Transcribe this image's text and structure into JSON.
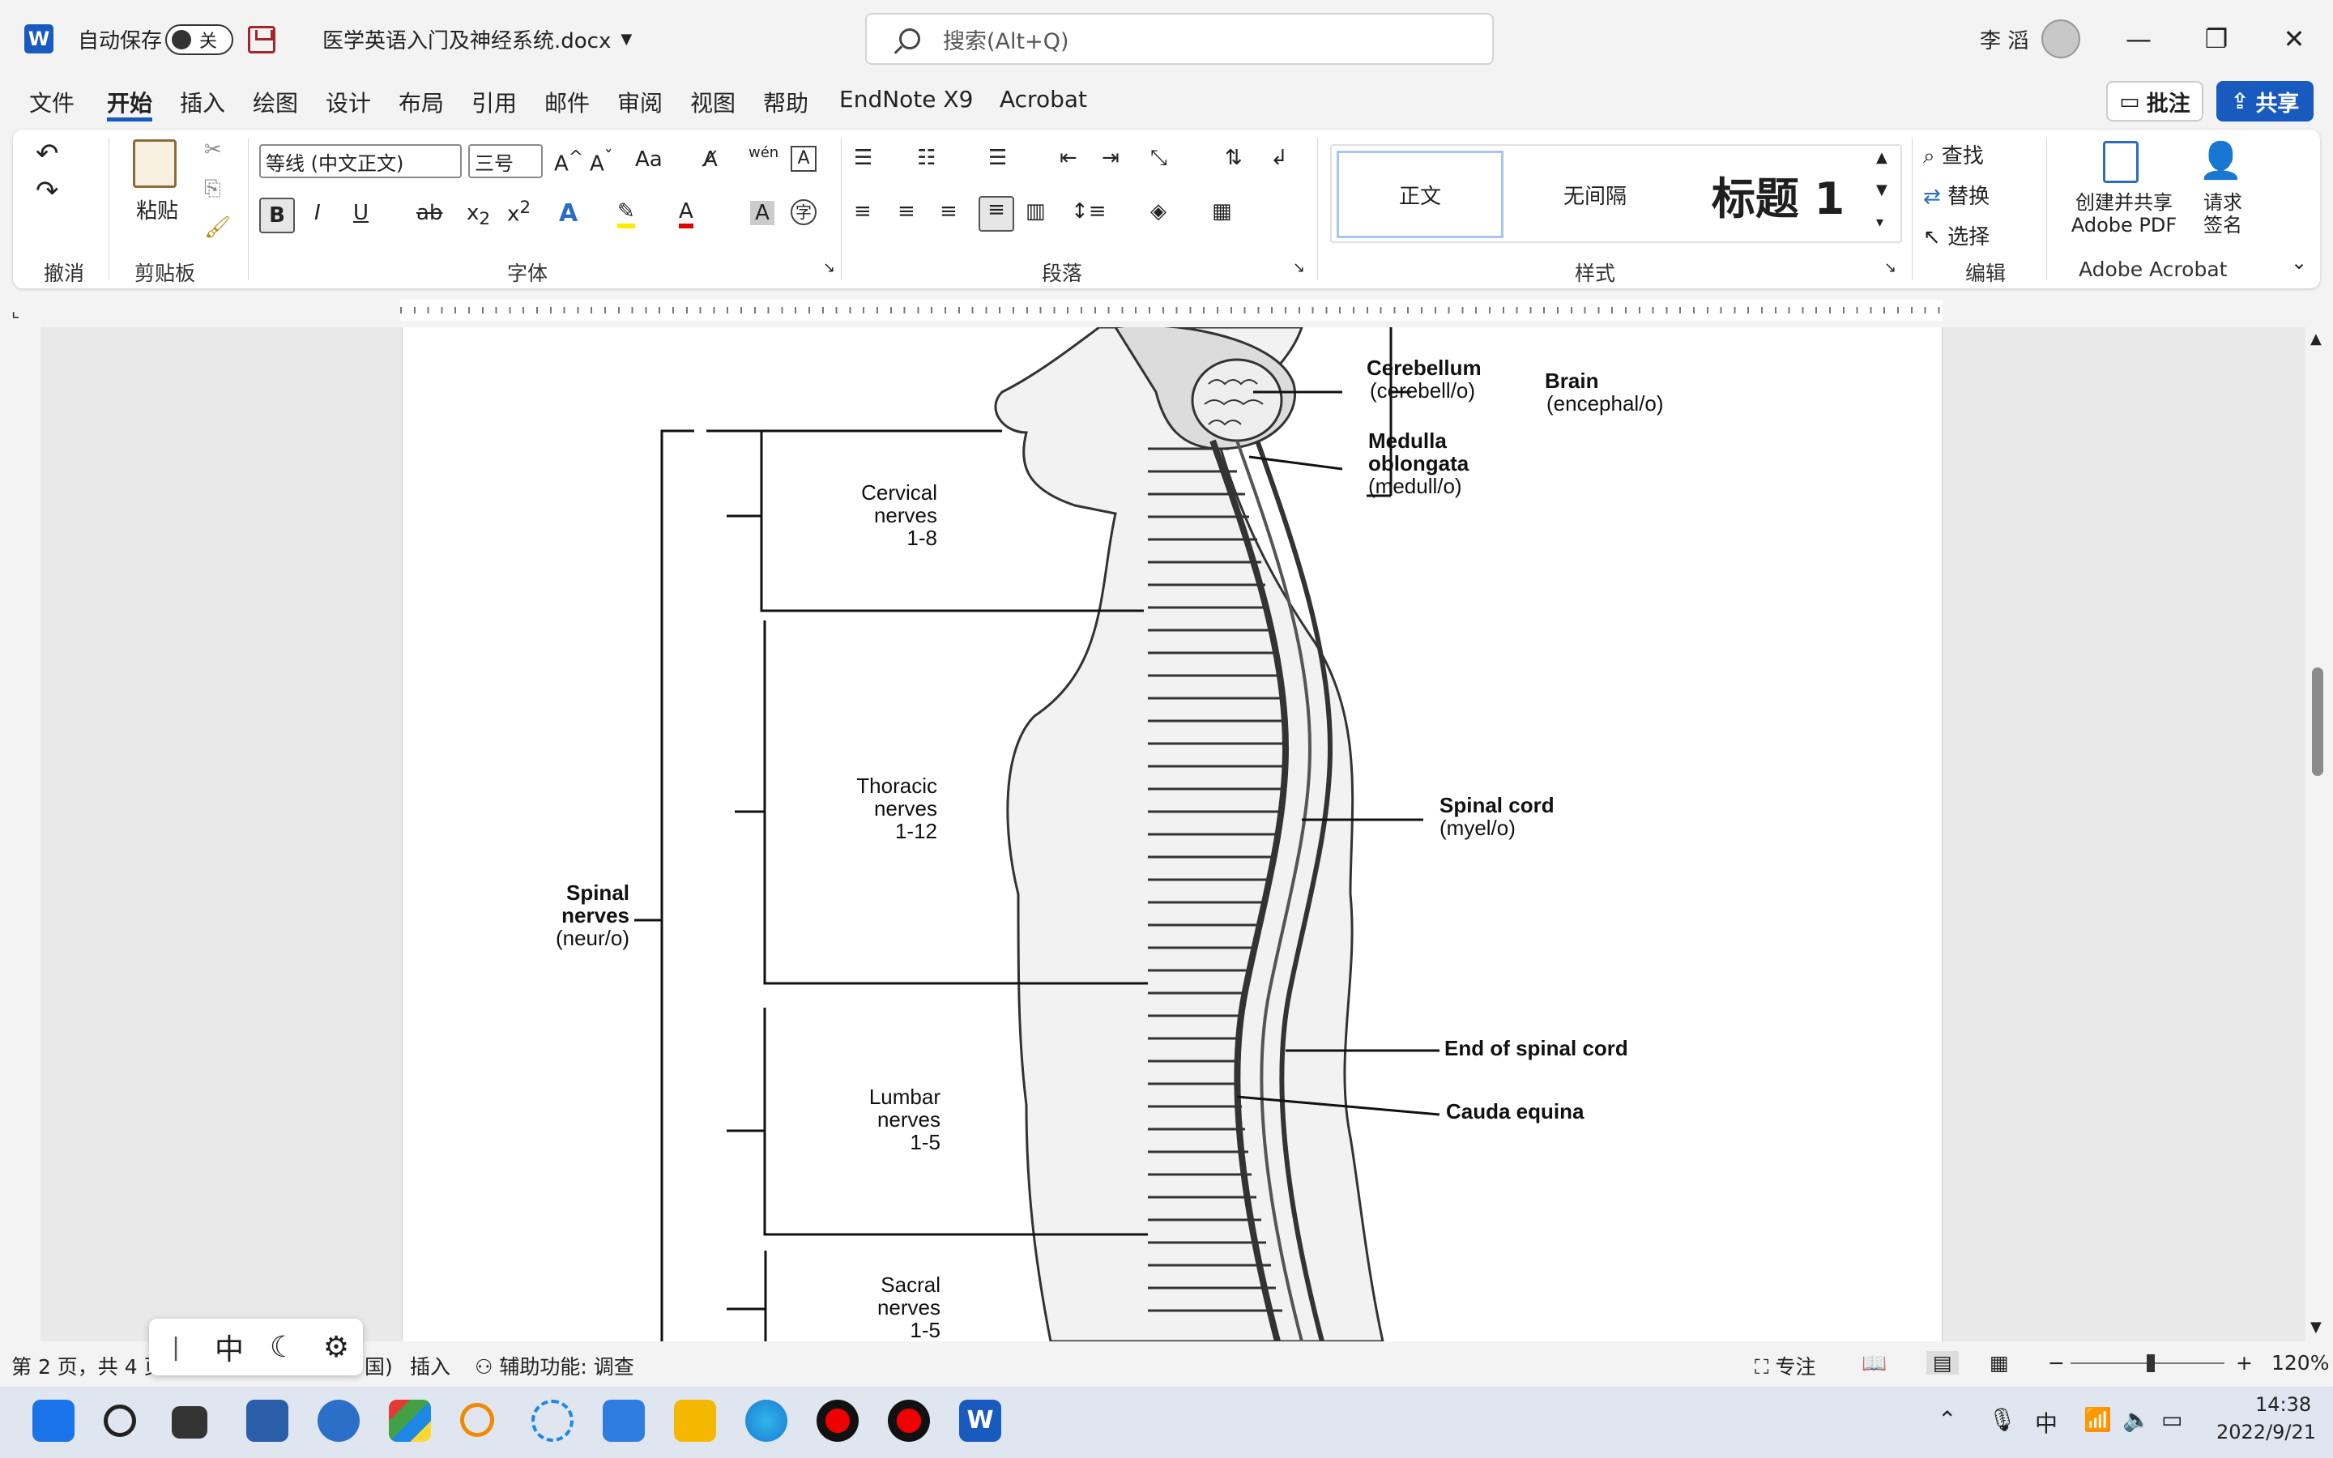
{
  "titlebar": {
    "autosave_label": "自动保存",
    "autosave_state": "关",
    "doc_title": "医学英语入门及神经系统.docx",
    "search_placeholder": "搜索(Alt+Q)",
    "user_name": "李 滔",
    "minimize": "—",
    "restore": "❐",
    "close": "✕"
  },
  "menu": {
    "tabs": [
      "文件",
      "开始",
      "插入",
      "绘图",
      "设计",
      "布局",
      "引用",
      "邮件",
      "审阅",
      "视图",
      "帮助",
      "EndNote X9",
      "Acrobat"
    ],
    "comments_button": "批注",
    "share_button": "共享"
  },
  "ribbon": {
    "groups": [
      "撤消",
      "剪贴板",
      "字体",
      "段落",
      "样式",
      "编辑",
      "Adobe Acrobat"
    ],
    "paste_label": "粘贴",
    "font_name": "等线 (中文正文)",
    "font_size": "三号",
    "styles": [
      "正文",
      "无间隔",
      "标题 1"
    ],
    "find_label": "查找",
    "replace_label": "替换",
    "select_label": "选择",
    "create_pdf_label": "创建并共享 Adobe PDF",
    "sign_label": "请求 签名",
    "bold": "B",
    "italic": "I",
    "underline": "U",
    "case": "Aa"
  },
  "figure": {
    "labels": {
      "cerebellum": "Cerebellum",
      "cerebellum_root": "(cerebell/o)",
      "brain": "Brain",
      "brain_root": "(encephal/o)",
      "medulla_1": "Medulla",
      "medulla_2": "oblongata",
      "medulla_root": "(medull/o)",
      "cervical_1": "Cervical",
      "cervical_2": "nerves",
      "cervical_3": "1-8",
      "thoracic_1": "Thoracic",
      "thoracic_2": "nerves",
      "thoracic_3": "1-12",
      "spinal_1": "Spinal",
      "spinal_2": "nerves",
      "spinal_root": "(neur/o)",
      "spinal_cord": "Spinal cord",
      "spinal_cord_root": "(myel/o)",
      "end_cord": "End of spinal cord",
      "cauda": "Cauda equina",
      "lumbar_1": "Lumbar",
      "lumbar_2": "nerves",
      "lumbar_3": "1-5",
      "sacral_1": "Sacral",
      "sacral_2": "nerves",
      "sacral_3": "1-5"
    }
  },
  "statusbar": {
    "page_info": "第 2 页，共 4 页",
    "mode_tail": "国)",
    "insert_mode": "插入",
    "accessibility": "辅助功能: 调查",
    "focus": "专注",
    "zoom": "120%"
  },
  "ime": {
    "mode": "中"
  },
  "taskbar": {
    "time": "14:38",
    "date": "2022/9/21",
    "lang": "中"
  },
  "colors": {
    "accent": "#185abd",
    "autosave_off": "#333333",
    "save_icon": "#a4262c"
  }
}
